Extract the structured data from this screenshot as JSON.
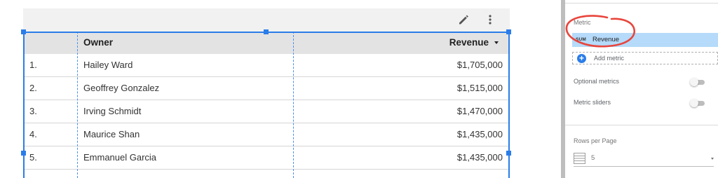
{
  "table": {
    "columns": {
      "owner": "Owner",
      "revenue": "Revenue"
    },
    "sort": {
      "column": "Revenue",
      "direction": "descending"
    },
    "rows": [
      {
        "index": "1.",
        "owner": "Hailey Ward",
        "revenue": "$1,705,000"
      },
      {
        "index": "2.",
        "owner": "Geoffrey Gonzalez",
        "revenue": "$1,515,000"
      },
      {
        "index": "3.",
        "owner": "Irving Schmidt",
        "revenue": "$1,470,000"
      },
      {
        "index": "4.",
        "owner": "Maurice Shan",
        "revenue": "$1,435,000"
      },
      {
        "index": "5.",
        "owner": "Emmanuel Garcia",
        "revenue": "$1,435,000"
      }
    ],
    "toolbar_icons": [
      "pencil-icon",
      "more-vert-icon"
    ]
  },
  "panel": {
    "metric_label": "Metric",
    "metric": {
      "aggregation": "SUM",
      "name": "Revenue"
    },
    "add_metric_label": "Add metric",
    "optional_metrics_label": "Optional metrics",
    "optional_metrics_enabled": false,
    "metric_sliders_label": "Metric sliders",
    "metric_sliders_enabled": false,
    "rows_per_page_label": "Rows per Page",
    "rows_per_page_value": "5"
  },
  "colors": {
    "selection": "#2b7de9",
    "header_bg": "#e3e3e3",
    "metric_chip": "#b5dafa",
    "annotation": "#e8453c"
  }
}
